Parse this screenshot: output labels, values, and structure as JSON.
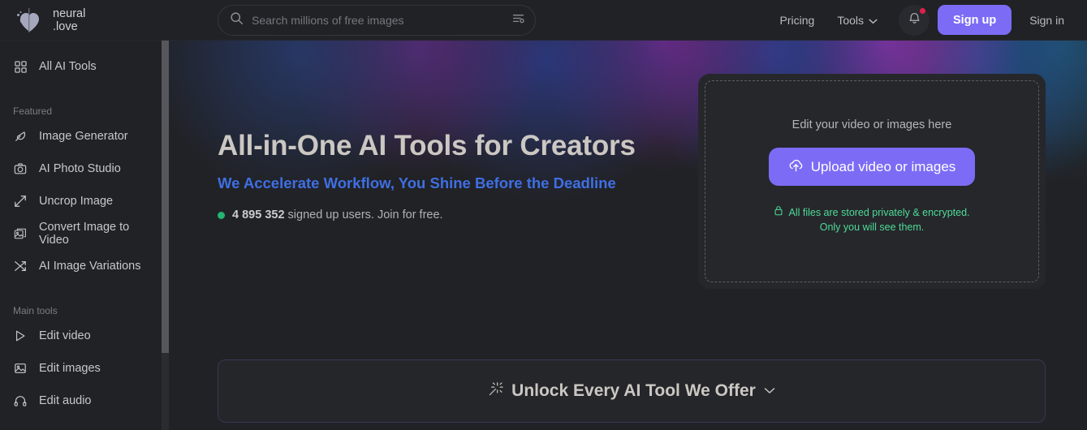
{
  "brand": {
    "logo_icon": "heart-logo-icon",
    "name_line1": "neural",
    "name_line2": ".love"
  },
  "search": {
    "icon": "search-icon",
    "placeholder": "Search millions of free images",
    "value": "",
    "filter_icon": "filter-settings-icon"
  },
  "nav": {
    "pricing": "Pricing",
    "tools": "Tools",
    "tools_chevron_icon": "chevron-down-icon",
    "notifications_icon": "bell-icon",
    "has_notification_dot": true,
    "sign_up": "Sign up",
    "sign_in": "Sign in"
  },
  "sidebar": {
    "top_item": {
      "label": "All AI Tools",
      "icon": "grid-icon"
    },
    "sections": [
      {
        "title": "Featured",
        "items": [
          {
            "label": "Image Generator",
            "icon": "feather-pen-icon"
          },
          {
            "label": "AI Photo Studio",
            "icon": "camera-icon"
          },
          {
            "label": "Uncrop Image",
            "icon": "expand-arrows-icon"
          },
          {
            "label": "Convert Image to Video",
            "icon": "image-to-video-icon"
          },
          {
            "label": "AI Image Variations",
            "icon": "shuffle-icon"
          }
        ]
      },
      {
        "title": "Main tools",
        "items": [
          {
            "label": "Edit video",
            "icon": "play-triangle-icon"
          },
          {
            "label": "Edit images",
            "icon": "image-icon"
          },
          {
            "label": "Edit audio",
            "icon": "headphones-icon"
          }
        ]
      }
    ]
  },
  "hero": {
    "headline": "All-in-One AI Tools for Creators",
    "subheadline": "We Accelerate Workflow, You Shine Before the Deadline",
    "user_count": "4 895 352",
    "user_count_suffix": "signed up users. Join for free.",
    "status_dot_color": "#22b573",
    "subheadline_color": "#3f6fe3"
  },
  "dropzone": {
    "title": "Edit your video or images here",
    "upload_button": "Upload video or images",
    "upload_icon": "cloud-upload-icon",
    "lock_icon": "lock-icon",
    "privacy_line1": "All files are stored privately & encrypted.",
    "privacy_line2": "Only you will see them.",
    "privacy_color": "#4ddb98",
    "button_color": "#7c6cf5"
  },
  "unlock": {
    "icon": "magic-wand-icon",
    "label": "Unlock Every AI Tool We Offer",
    "chevron_icon": "chevron-down-icon"
  }
}
